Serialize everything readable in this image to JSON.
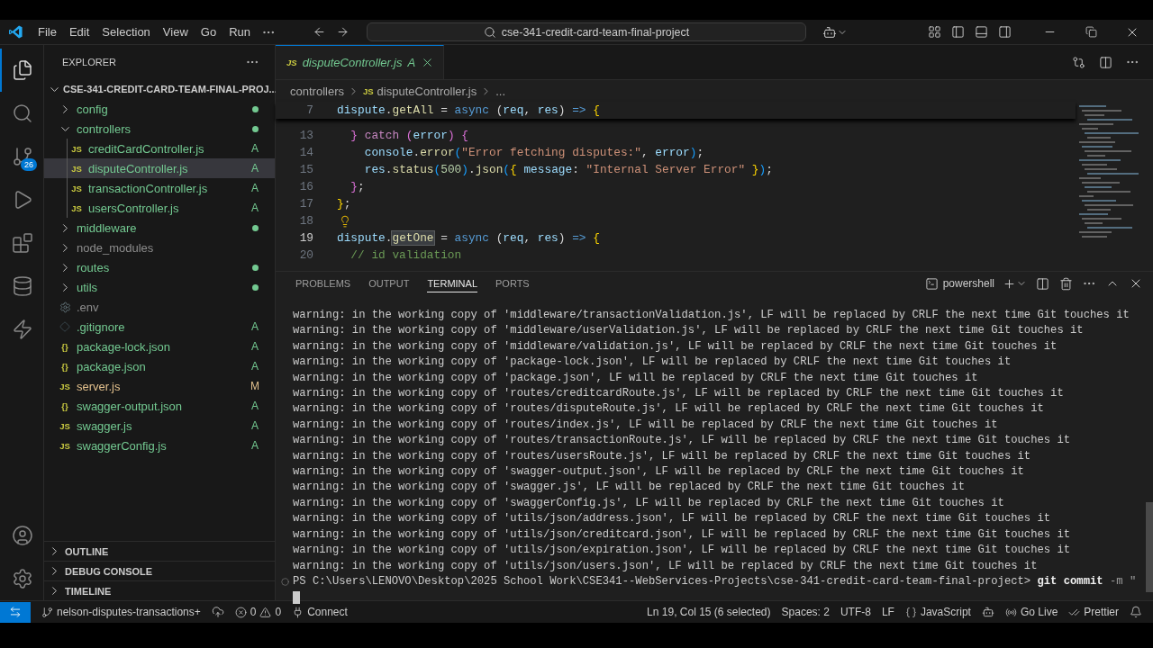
{
  "title_bar": {
    "menus": [
      "File",
      "Edit",
      "Selection",
      "View",
      "Go",
      "Run"
    ],
    "command_center": "cse-341-credit-card-team-final-project"
  },
  "activity_bar": {
    "top": [
      {
        "kind": "explorer",
        "selected": true
      },
      {
        "kind": "search",
        "selected": false
      },
      {
        "kind": "scm",
        "selected": false,
        "badge": "26"
      },
      {
        "kind": "run",
        "selected": false
      },
      {
        "kind": "extensions",
        "selected": false
      },
      {
        "kind": "database",
        "selected": false
      },
      {
        "kind": "thunder",
        "selected": false
      }
    ],
    "bottom": [
      {
        "kind": "account"
      },
      {
        "kind": "settings"
      }
    ]
  },
  "explorer": {
    "title": "EXPLORER",
    "root": {
      "label": "CSE-341-CREDIT-CARD-TEAM-FINAL-PROJ...",
      "expanded": true,
      "children": [
        {
          "label": "config",
          "kind": "folder",
          "expanded": false,
          "has_changes": true,
          "ignored": false,
          "selected": false
        },
        {
          "label": "controllers",
          "kind": "folder",
          "expanded": true,
          "has_changes": true,
          "ignored": false,
          "selected": false,
          "children": [
            {
              "label": "creditCardController.js",
              "kind": "js",
              "icon_text": "JS",
              "badge": "A",
              "modified": false,
              "ignored": false,
              "selected": false
            },
            {
              "label": "disputeController.js",
              "kind": "js",
              "icon_text": "JS",
              "badge": "A",
              "modified": false,
              "ignored": false,
              "selected": true
            },
            {
              "label": "transactionController.js",
              "kind": "js",
              "icon_text": "JS",
              "badge": "A",
              "modified": false,
              "ignored": false,
              "selected": false
            },
            {
              "label": "usersController.js",
              "kind": "js",
              "icon_text": "JS",
              "badge": "A",
              "modified": false,
              "ignored": false,
              "selected": false
            }
          ]
        },
        {
          "label": "middleware",
          "kind": "folder",
          "expanded": false,
          "has_changes": true,
          "ignored": false,
          "selected": false
        },
        {
          "label": "node_modules",
          "kind": "folder",
          "expanded": false,
          "has_changes": false,
          "ignored": true,
          "selected": false
        },
        {
          "label": "routes",
          "kind": "folder",
          "expanded": false,
          "has_changes": true,
          "ignored": false,
          "selected": false
        },
        {
          "label": "utils",
          "kind": "folder",
          "expanded": false,
          "has_changes": true,
          "ignored": false,
          "selected": false
        },
        {
          "label": ".env",
          "kind": "env",
          "ignored": true,
          "selected": false
        },
        {
          "label": ".gitignore",
          "kind": "git",
          "badge": "A",
          "modified": false,
          "ignored": false,
          "selected": false
        },
        {
          "label": "package-lock.json",
          "kind": "json",
          "icon_text": "{}",
          "badge": "A",
          "modified": false,
          "ignored": false,
          "selected": false
        },
        {
          "label": "package.json",
          "kind": "json",
          "icon_text": "{}",
          "badge": "A",
          "modified": false,
          "ignored": false,
          "selected": false
        },
        {
          "label": "server.js",
          "kind": "js",
          "icon_text": "JS",
          "badge": "M",
          "modified": true,
          "ignored": false,
          "selected": false
        },
        {
          "label": "swagger-output.json",
          "kind": "json",
          "icon_text": "{}",
          "badge": "A",
          "modified": false,
          "ignored": false,
          "selected": false
        },
        {
          "label": "swagger.js",
          "kind": "js",
          "icon_text": "JS",
          "badge": "A",
          "modified": false,
          "ignored": false,
          "selected": false
        },
        {
          "label": "swaggerConfig.js",
          "kind": "js",
          "icon_text": "JS",
          "badge": "A",
          "modified": false,
          "ignored": false,
          "selected": false
        }
      ]
    },
    "sections": [
      {
        "label": "OUTLINE",
        "expanded": false
      },
      {
        "label": "DEBUG CONSOLE",
        "expanded": false
      },
      {
        "label": "TIMELINE",
        "expanded": false
      }
    ]
  },
  "tabs": [
    {
      "label": "disputeController.js",
      "icon_text": "JS",
      "badge": "A",
      "selected": true
    }
  ],
  "breadcrumbs": {
    "folder": "controllers",
    "icon_text": "JS",
    "file": "disputeController.js",
    "more": "..."
  },
  "editor": {
    "sticky": {
      "number": "7",
      "tokens": [
        {
          "t": "dispute",
          "kind": "v"
        },
        {
          "t": ".",
          "kind": "p"
        },
        {
          "t": "getAll",
          "kind": "f"
        },
        {
          "t": " = ",
          "kind": "p"
        },
        {
          "t": "async",
          "kind": "k"
        },
        {
          "t": " (",
          "kind": "p"
        },
        {
          "t": "req",
          "kind": "v"
        },
        {
          "t": ", ",
          "kind": "p"
        },
        {
          "t": "res",
          "kind": "v"
        },
        {
          "t": ") ",
          "kind": "p"
        },
        {
          "t": "=>",
          "kind": "k"
        },
        {
          "t": " {",
          "kind": "b1"
        }
      ]
    },
    "lines": [
      {
        "number": "13",
        "current": false,
        "tokens": [
          {
            "t": "  }",
            "kind": "b2"
          },
          {
            "t": " catch",
            "kind": "c"
          },
          {
            "t": " (",
            "kind": "b2"
          },
          {
            "t": "error",
            "kind": "v"
          },
          {
            "t": ")",
            "kind": "b2"
          },
          {
            "t": " {",
            "kind": "b2"
          }
        ]
      },
      {
        "number": "14",
        "current": false,
        "tokens": [
          {
            "t": "    console",
            "kind": "v"
          },
          {
            "t": ".",
            "kind": "p"
          },
          {
            "t": "error",
            "kind": "f"
          },
          {
            "t": "(",
            "kind": "b3"
          },
          {
            "t": "\"Error fetching disputes:\"",
            "kind": "s"
          },
          {
            "t": ", ",
            "kind": "p"
          },
          {
            "t": "error",
            "kind": "v"
          },
          {
            "t": ")",
            "kind": "b3"
          },
          {
            "t": ";",
            "kind": "p"
          }
        ]
      },
      {
        "number": "15",
        "current": false,
        "tokens": [
          {
            "t": "    res",
            "kind": "v"
          },
          {
            "t": ".",
            "kind": "p"
          },
          {
            "t": "status",
            "kind": "f"
          },
          {
            "t": "(",
            "kind": "b3"
          },
          {
            "t": "500",
            "kind": "n"
          },
          {
            "t": ")",
            "kind": "b3"
          },
          {
            "t": ".",
            "kind": "p"
          },
          {
            "t": "json",
            "kind": "f"
          },
          {
            "t": "(",
            "kind": "b3"
          },
          {
            "t": "{",
            "kind": "b1"
          },
          {
            "t": " message",
            "kind": "v"
          },
          {
            "t": ": ",
            "kind": "p"
          },
          {
            "t": "\"Internal Server Error\"",
            "kind": "s"
          },
          {
            "t": " }",
            "kind": "b1"
          },
          {
            "t": ")",
            "kind": "b3"
          },
          {
            "t": ";",
            "kind": "p"
          }
        ]
      },
      {
        "number": "16",
        "current": false,
        "tokens": [
          {
            "t": "  }",
            "kind": "b2"
          },
          {
            "t": ";",
            "kind": "p"
          }
        ]
      },
      {
        "number": "17",
        "current": false,
        "tokens": [
          {
            "t": "}",
            "kind": "b1"
          },
          {
            "t": ";",
            "kind": "p"
          }
        ]
      },
      {
        "number": "18",
        "current": false,
        "lightbulb": true
      },
      {
        "number": "19",
        "current": true,
        "tokens": [
          {
            "t": "dispute",
            "kind": "v"
          },
          {
            "t": ".",
            "kind": "p"
          },
          {
            "t": "getOne",
            "kind": "f",
            "sel": true
          },
          {
            "t": " = ",
            "kind": "p"
          },
          {
            "t": "async",
            "kind": "k"
          },
          {
            "t": " (",
            "kind": "p"
          },
          {
            "t": "req",
            "kind": "v"
          },
          {
            "t": ", ",
            "kind": "p"
          },
          {
            "t": "res",
            "kind": "v"
          },
          {
            "t": ") ",
            "kind": "p"
          },
          {
            "t": "=>",
            "kind": "k"
          },
          {
            "t": " {",
            "kind": "b1"
          }
        ]
      },
      {
        "number": "20",
        "current": false,
        "tokens": [
          {
            "t": "  // id validation",
            "kind": "m"
          }
        ]
      }
    ]
  },
  "panel": {
    "tabs": [
      {
        "label": "PROBLEMS",
        "selected": false
      },
      {
        "label": "OUTPUT",
        "selected": false
      },
      {
        "label": "TERMINAL",
        "selected": true
      },
      {
        "label": "PORTS",
        "selected": false
      }
    ],
    "shell": "powershell",
    "terminal": {
      "lines": [
        "warning: in the working copy of 'middleware/transactionValidation.js', LF will be replaced by CRLF the next time Git touches it",
        "warning: in the working copy of 'middleware/userValidation.js', LF will be replaced by CRLF the next time Git touches it",
        "warning: in the working copy of 'middleware/validation.js', LF will be replaced by CRLF the next time Git touches it",
        "warning: in the working copy of 'package-lock.json', LF will be replaced by CRLF the next time Git touches it",
        "warning: in the working copy of 'package.json', LF will be replaced by CRLF the next time Git touches it",
        "warning: in the working copy of 'routes/creditcardRoute.js', LF will be replaced by CRLF the next time Git touches it",
        "warning: in the working copy of 'routes/disputeRoute.js', LF will be replaced by CRLF the next time Git touches it",
        "warning: in the working copy of 'routes/index.js', LF will be replaced by CRLF the next time Git touches it",
        "warning: in the working copy of 'routes/transactionRoute.js', LF will be replaced by CRLF the next time Git touches it",
        "warning: in the working copy of 'routes/usersRoute.js', LF will be replaced by CRLF the next time Git touches it",
        "warning: in the working copy of 'swagger-output.json', LF will be replaced by CRLF the next time Git touches it",
        "warning: in the working copy of 'swagger.js', LF will be replaced by CRLF the next time Git touches it",
        "warning: in the working copy of 'swaggerConfig.js', LF will be replaced by CRLF the next time Git touches it",
        "warning: in the working copy of 'utils/json/address.json', LF will be replaced by CRLF the next time Git touches it",
        "warning: in the working copy of 'utils/json/creditcard.json', LF will be replaced by CRLF the next time Git touches it",
        "warning: in the working copy of 'utils/json/expiration.json', LF will be replaced by CRLF the next time Git touches it",
        "warning: in the working copy of 'utils/json/users.json', LF will be replaced by CRLF the next time Git touches it"
      ],
      "prompt": "PS C:\\Users\\LENOVO\\Desktop\\2025 School Work\\CSE341--WebServices-Projects\\cse-341-credit-card-team-final-project>",
      "command": "git commit",
      "args": "-m \"",
      "cursor": true
    }
  },
  "status_bar": {
    "left": [
      {
        "kind": "remote"
      },
      {
        "kind": "branch",
        "text": "nelson-disputes-transactions+"
      },
      {
        "kind": "sync"
      },
      {
        "kind": "problems",
        "errors": "0",
        "warnings": "0"
      },
      {
        "kind": "connect",
        "text": "Connect"
      }
    ],
    "right": [
      {
        "kind": "text",
        "text": "Ln 19, Col 15 (6 selected)"
      },
      {
        "kind": "text",
        "text": "Spaces: 2"
      },
      {
        "kind": "text",
        "text": "UTF-8"
      },
      {
        "kind": "text",
        "text": "LF"
      },
      {
        "kind": "language",
        "text": "JavaScript"
      },
      {
        "kind": "copilot"
      },
      {
        "kind": "golive",
        "text": "Go Live"
      },
      {
        "kind": "prettier",
        "text": "Prettier"
      },
      {
        "kind": "bell"
      }
    ]
  }
}
